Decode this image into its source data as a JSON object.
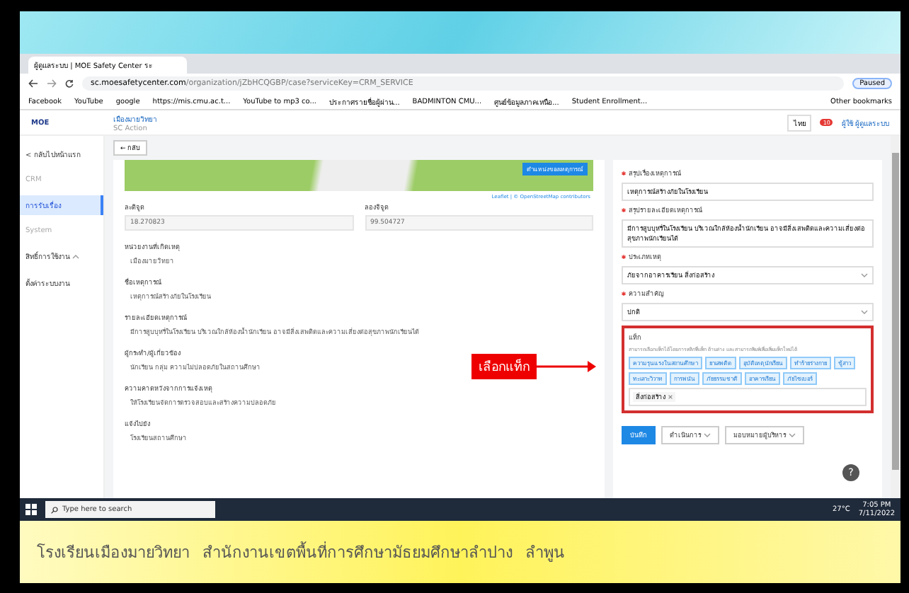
{
  "browser": {
    "tab_title": "ผู้ดูแลระบบ | MOE Safety Center ระ",
    "url_host": "sc.moesafetycenter.com",
    "url_path": "/organization/jZbHCQGBP/case?serviceKey=CRM_SERVICE",
    "profile": "Paused",
    "bookmarks": [
      "Facebook",
      "YouTube",
      "google",
      "https://mis.cmu.ac.t...",
      "YouTube to mp3 co...",
      "ประกาศรายชื่อผู้ผ่าน...",
      "BADMINTON CMU...",
      "ศูนย์ข้อมูลภาคเหนือ...",
      "Student Enrollment..."
    ],
    "other_bookmarks": "Other bookmarks"
  },
  "app": {
    "logo": "MOE",
    "org_name": "เมืองมายวิทยา",
    "org_sub": "SC Action",
    "language": "ไทย",
    "notification_count": "10",
    "user": "ผู้ใช้ ผู้ดูแลระบบ",
    "sidebar": {
      "back": "< กลับไปหน้าแรก",
      "sections": [
        {
          "heading": "CRM",
          "items": [
            {
              "label": "การรับเรื่อง",
              "selected": true,
              "expandable": false
            }
          ]
        },
        {
          "heading": "System",
          "items": [
            {
              "label": "สิทธิ์การใช้งาน",
              "selected": false,
              "expandable": true
            },
            {
              "label": "ตั้งค่าระบบงาน",
              "selected": false,
              "expandable": false
            }
          ]
        }
      ]
    },
    "back_button": "← กลับ",
    "map": {
      "location_button": "ตำแหน่งของเหตุการณ์",
      "attribution": "Leaflet | © OpenStreetMap contributors"
    },
    "coordinates": [
      {
        "label": "ละติจูด",
        "value": "18.270823"
      },
      {
        "label": "ลองจิจูด",
        "value": "99.504727"
      }
    ],
    "details": [
      {
        "label": "หน่วยงานที่เกิดเหตุ",
        "value": "เมืองมายวิทยา"
      },
      {
        "label": "ชื่อเหตุการณ์",
        "value": "เหตุการณ์สร้างภัยในโรงเรียน"
      },
      {
        "label": "รายละเอียดเหตุการณ์",
        "value": "มีการสูบบุหรี่ในโรงเรียน บริเวณใกล้ห้องน้ำนักเรียน อาจมีสิ่งเสพติดและความเสี่ยงต่อสุขภาพนักเรียนได้"
      },
      {
        "label": "ผู้กระทำ/ผู้เกี่ยวข้อง",
        "value": "นักเรียน กลุ่ม ความไม่ปลอดภัยในสถานศึกษา"
      },
      {
        "label": "ความคาดหวังจากการแจ้งเหตุ",
        "value": "ให้โรงเรียนจัดการตรวจสอบและสร้างความปลอดภัย"
      },
      {
        "label": "แจ้งไปยัง",
        "value": "โรงเรียนสถานศึกษา"
      }
    ],
    "form": {
      "fields": [
        {
          "label": "สรุปเรื่องเหตุการณ์",
          "required": true,
          "kind": "input",
          "value": "เหตุการณ์สร้างภัยในโรงเรียน"
        },
        {
          "label": "สรุปรายละเอียดเหตุการณ์",
          "required": true,
          "kind": "textarea",
          "value": "มีการสูบบุหรี่ในโรงเรียน บริเวณใกล้ห้องน้ำนักเรียน อาจมีสิ่งเสพติดและความเสี่ยงต่อสุขภาพนักเรียนได้"
        },
        {
          "label": "ประเภทเหตุ",
          "required": true,
          "kind": "select",
          "value": "ภัยจากอาคารเรียน สิ่งก่อสร้าง"
        },
        {
          "label": "ความสำคัญ",
          "required": true,
          "kind": "select",
          "value": "ปกติ"
        }
      ],
      "tags": {
        "label": "แท็ก",
        "hint": "สามารถเลือกแท็กได้โดยการคลิกที่แท็ก ด้านล่าง และสามารถพิมพ์เพื่อเพิ่มแท็กใหม่ได้",
        "options": [
          "ความรุนแรงในสถานศึกษา",
          "ยาเสพติด",
          "อุบัติเหตุนักเรียน",
          "ทำร้ายร่างกาย",
          "ชู้สาว",
          "ทะเลาะวิวาท",
          "การพนัน",
          "ภัยธรรมชาติ",
          "อาคารเรียน",
          "ภัยไซเบอร์"
        ],
        "selected": [
          "สิ่งก่อสร้าง"
        ]
      },
      "buttons": [
        {
          "label": "บันทึก",
          "kind": "primary"
        },
        {
          "label": "ดำเนินการ",
          "kind": "dropdown"
        },
        {
          "label": "มอบหมายผู้บริหาร",
          "kind": "dropdown"
        }
      ]
    },
    "annotation": "เลือกแท็ก",
    "help": "?"
  },
  "taskbar": {
    "search_placeholder": "Type here to search",
    "weather": "27°C",
    "time": "7:05 PM",
    "date": "7/11/2022"
  },
  "caption": [
    "โรงเรียนเมืองมายวิทยา",
    "สำนักงานเขตพื้นที่การศึกษามัธยมศึกษาลำปาง",
    "ลำพูน"
  ]
}
